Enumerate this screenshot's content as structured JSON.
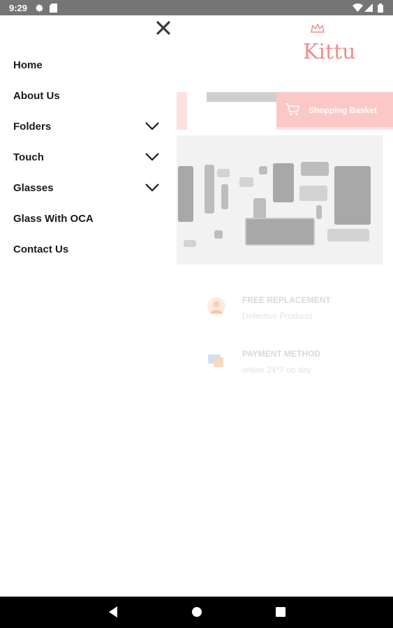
{
  "status_bar": {
    "time": "9:29",
    "icons": [
      "settings-icon",
      "sd-card-icon",
      "wifi-icon",
      "signal-icon",
      "battery-icon"
    ]
  },
  "background_page": {
    "logo_text": "Kittu",
    "basket_label": "Shopping Basket",
    "features": [
      {
        "title": "FREE REPLACEMENT",
        "subtitle": "Defective Products",
        "icon": "replacement-icon"
      },
      {
        "title": "PAYMENT METHOD",
        "subtitle": "online 24*7 on day",
        "icon": "payment-icon"
      }
    ],
    "accent_color": "#f28c8c"
  },
  "drawer": {
    "close_icon": "close-icon",
    "items": [
      {
        "label": "Home",
        "expandable": false
      },
      {
        "label": "About Us",
        "expandable": false
      },
      {
        "label": "Folders",
        "expandable": true
      },
      {
        "label": "Touch",
        "expandable": true
      },
      {
        "label": "Glasses",
        "expandable": true
      },
      {
        "label": "Glass With OCA",
        "expandable": false
      },
      {
        "label": "Contact Us",
        "expandable": false
      }
    ]
  },
  "nav_bar": {
    "buttons": [
      "back-icon",
      "home-icon",
      "recents-icon"
    ]
  }
}
